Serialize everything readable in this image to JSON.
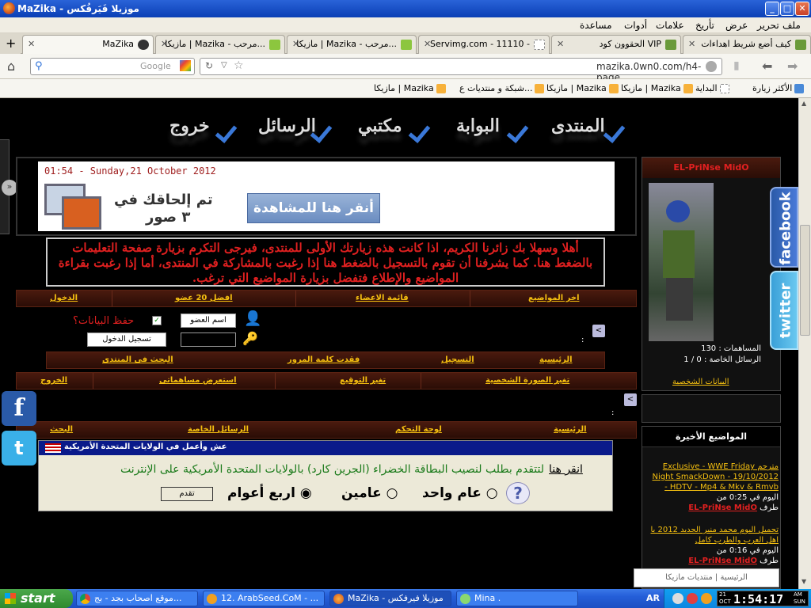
{
  "window": {
    "title": "MaZika - موزيلا فَيَرفُكس"
  },
  "menu": [
    "ملف",
    "تحرير",
    "عرض",
    "تأريخ",
    "علامات",
    "أدوات",
    "مساعدة"
  ],
  "tabs": [
    {
      "label": "كيف أضع شريط اهداءات",
      "active": false
    },
    {
      "label": "الحقوون كود VIP",
      "active": false
    },
    {
      "label": "Servimg.com - 11110 -",
      "active": false
    },
    {
      "label": "مازيكا | Mazika - مرحب...",
      "active": false
    },
    {
      "label": "مازيكا | Mazika - مرحب...",
      "active": false
    },
    {
      "label": "MaZika",
      "active": true
    }
  ],
  "nav": {
    "url": "mazika.0wn0.com/h4-page",
    "search_placeholder": "Google"
  },
  "bookmarks": [
    "الأكثر زيارة",
    "البداية",
    "مازيكا | Mazika",
    "مازيكا | Mazika",
    "شبكة و منتديات ع...",
    "مازيكا | Mazika"
  ],
  "site": {
    "nav": [
      "المنتدى",
      "البوابة",
      "مكتبي",
      "الرسائل",
      "خروج"
    ],
    "datetime": "01:54 - Sunday,21 October 2012",
    "ad": {
      "text1": "تم إلحاقك في",
      "text2": "٣ صور",
      "button": "أنقر هنا للمشاهدة"
    },
    "welcome": "أهلا وسهلا بك زائرنا الكريم، اذا كانت هذه زيارتك الأولى للمنتدى، فيرجى التكرم بزيارة صفحة التعليمات بالضغط هنا. كما يشرفنا أن تقوم بالتسجيل بالضغط هنا إذا رغبت بالمشاركة في المنتدى، أما إذا رغبت بقراءة المواضيع والإطلاع فتفضل بزيارة المواضيع التي ترغب.",
    "bar1": [
      "اخر المواضيع",
      "قائمة الاعضاء",
      "افضل 20 عضو",
      "الدخول"
    ],
    "login": {
      "username_btn": "اسم العضو",
      "remember": "حفظ البيانات؟",
      "login_btn": "تسجيل الدخول"
    },
    "bar2": [
      "الرئيسية",
      "التسجيل",
      "فقدت كلمة المرور",
      "البحث فى المنتدى"
    ],
    "bar3": [
      "تغير الصورة الشخصية",
      "تغير التوقيع",
      "استعرض مساهماتى",
      "الخروج"
    ],
    "bar4": [
      "الرئيسية",
      "لوحة التحكم",
      "الرسائل الخاصة",
      "البحث"
    ],
    "greencard": {
      "header": "عش وأعمل في الولايات المتحدة الأمريكية",
      "link": "انقر هنا",
      "line": "لتتقدم بطلب لنصيب البطاقة الخضراء (الجرين كارد) بالولايات المتحدة الأمريكية على الإنترنت",
      "opt1": "عام واحد",
      "opt2": "عامين",
      "opt3": "اربع أعوام",
      "submit": "تقدم"
    },
    "profile": {
      "name": "EL-PriNse MidO",
      "posts": "المساهمات : 130",
      "pm": "الرسائل الخاصة : 0 / 1",
      "data_link": "البيانات الشخصية"
    },
    "social": {
      "facebook": "facebook",
      "twitter": "twitter"
    },
    "recent": {
      "title": "المواضيع الأخيرة",
      "items": [
        {
          "title": "مترجم Exclusive - WWE Friday Night SmackDown - 19/10/2012 - HDTV - Mp4 & Mkv & Rmvb",
          "time": "اليوم في 0:25 من",
          "by": "طرف",
          "author": "EL-PriNse MidO"
        },
        {
          "title": "تحميل البوم محمد منير الجديد 2012 يا اهل العرب والطرب كامل",
          "time": "اليوم في 0:16 من",
          "by": "طرف",
          "author": "EL-PriNse MidO"
        }
      ]
    },
    "footer_box": "الرئيسية | منتديات مازيكا"
  },
  "taskbar": {
    "start": "start",
    "items": [
      "موقع اصحاب بجد - بج...",
      "12. ArabSeed.CoM - ...",
      "MaZika - موزيلا فيرفكس",
      "Mina ."
    ],
    "lang": "AR",
    "time": "1:54:17",
    "ampm": "AM",
    "day": "SUN",
    "date": "21",
    "month": "OCT"
  },
  "colors": {
    "titlebar": "#0a3fb5",
    "link_gold": "#f5c010",
    "red": "#e02020",
    "brown_bar": "#3a140a"
  }
}
